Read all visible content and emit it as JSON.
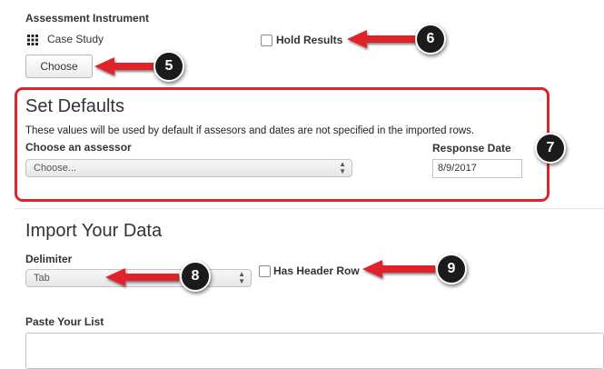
{
  "assessment": {
    "heading": "Assessment Instrument",
    "instrument_name": "Case Study",
    "choose_label": "Choose",
    "hold_results_label": "Hold Results"
  },
  "defaults": {
    "title": "Set Defaults",
    "description": "These values will be used by default if assesors and dates are not specified in the imported rows.",
    "assessor_label": "Choose an assessor",
    "assessor_value": "Choose...",
    "response_date_label": "Response Date",
    "response_date_value": "8/9/2017"
  },
  "import": {
    "title": "Import Your Data",
    "delimiter_label": "Delimiter",
    "delimiter_value": "Tab",
    "header_row_label": "Has Header Row",
    "paste_label": "Paste Your List",
    "paste_value": ""
  },
  "callouts": {
    "c5": "5",
    "c6": "6",
    "c7": "7",
    "c8": "8",
    "c9": "9"
  },
  "colors": {
    "accent_red": "#e0242b",
    "badge": "#1b1b1b"
  }
}
